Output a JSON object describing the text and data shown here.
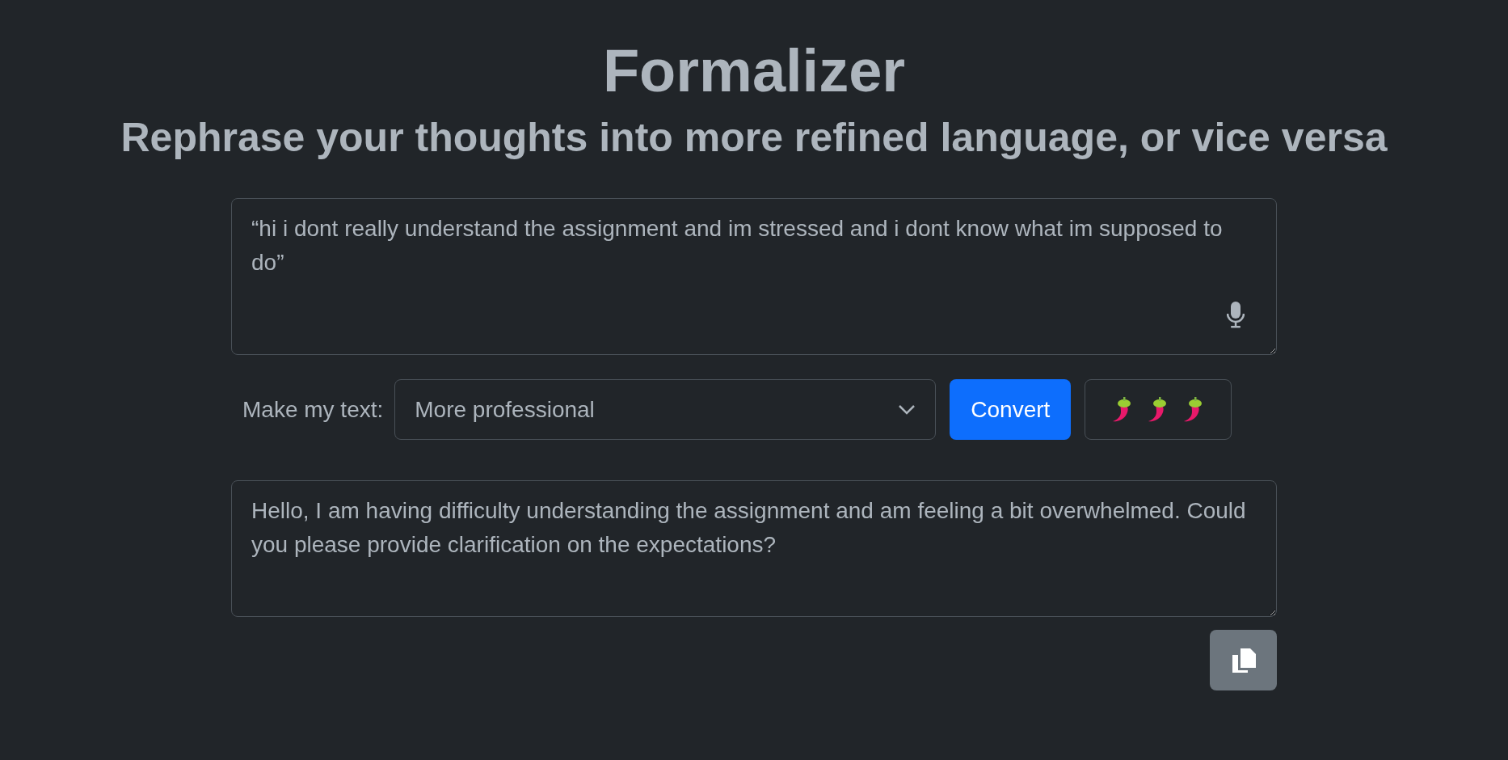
{
  "header": {
    "title": "Formalizer",
    "subtitle": "Rephrase your thoughts into more refined language, or vice versa"
  },
  "input": {
    "value": "“hi i dont really understand the assignment and im stressed and i dont know what im supposed to do”"
  },
  "controls": {
    "label": "Make my text:",
    "select_value": "More professional",
    "convert_button": "Convert"
  },
  "output": {
    "value": "Hello, I am having difficulty understanding the assignment and am feeling a bit overwhelmed. Could you please provide clarification on the expectations?"
  }
}
